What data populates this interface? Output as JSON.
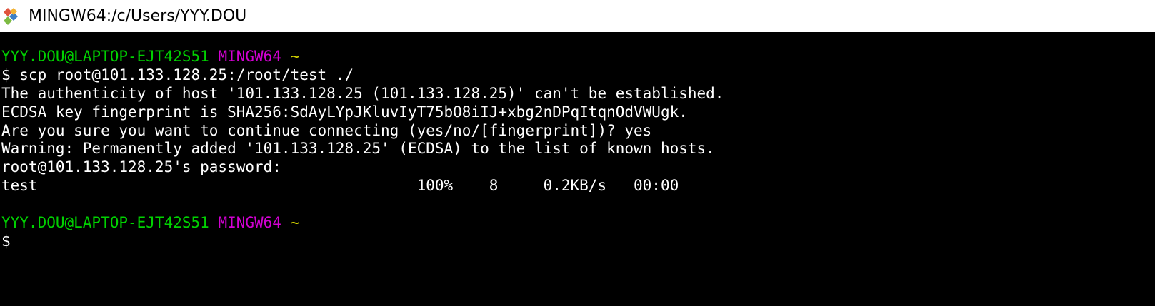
{
  "window": {
    "title": "MINGW64:/c/Users/YYY.DOU",
    "icon": "git-bash-icon"
  },
  "colors": {
    "user_host": "#00d100",
    "system": "#d200d2",
    "path": "#d2d200",
    "text": "#ffffff",
    "background": "#000000"
  },
  "terminal": {
    "prompt1": {
      "user_host": "YYY.DOU@LAPTOP-EJT42S51",
      "system": "MINGW64",
      "path": "~"
    },
    "command": "$ scp root@101.133.128.25:/root/test ./",
    "output": [
      "The authenticity of host '101.133.128.25 (101.133.128.25)' can't be established.",
      "ECDSA key fingerprint is SHA256:SdAyLYpJKluvIyT75bO8iIJ+xbg2nDPqItqnOdVWUgk.",
      "Are you sure you want to continue connecting (yes/no/[fingerprint])? yes",
      "Warning: Permanently added '101.133.128.25' (ECDSA) to the list of known hosts.",
      "root@101.133.128.25's password:"
    ],
    "transfer": "test                                          100%    8     0.2KB/s   00:00",
    "prompt2": {
      "user_host": "YYY.DOU@LAPTOP-EJT42S51",
      "system": "MINGW64",
      "path": "~"
    },
    "cursor_prompt": "$"
  }
}
